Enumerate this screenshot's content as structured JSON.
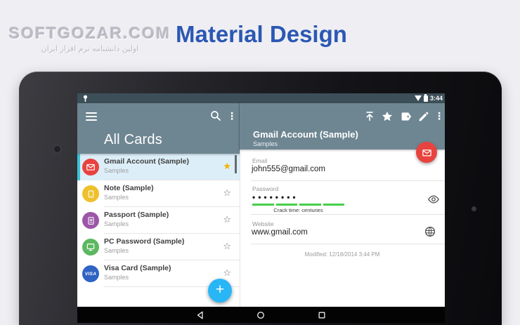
{
  "page": {
    "title": "Material Design"
  },
  "watermark": {
    "brand": "SOFTGOZAR.COM",
    "tagline": "اولین دانشنامه نرم افزار ایران"
  },
  "status_bar": {
    "time": "3:44"
  },
  "left_panel": {
    "title": "All Cards",
    "cards": [
      {
        "title": "Gmail Account (Sample)",
        "subtitle": "Samples",
        "icon": "envelope-icon",
        "color": "#e8433f",
        "starred": true,
        "selected": true
      },
      {
        "title": "Note (Sample)",
        "subtitle": "Samples",
        "icon": "note-icon",
        "color": "#eec12c",
        "starred": false,
        "selected": false
      },
      {
        "title": "Passport (Sample)",
        "subtitle": "Samples",
        "icon": "passport-icon",
        "color": "#9c56a8",
        "starred": false,
        "selected": false
      },
      {
        "title": "PC Password (Sample)",
        "subtitle": "Samples",
        "icon": "monitor-icon",
        "color": "#5cb860",
        "starred": false,
        "selected": false
      },
      {
        "title": "Visa Card (Sample)",
        "subtitle": "Samples",
        "icon": "visa-icon",
        "color": "#2f63c4",
        "icon_text": "VISA",
        "starred": false,
        "selected": false
      }
    ]
  },
  "detail_panel": {
    "title": "Gmail Account (Sample)",
    "subtitle": "Samples",
    "email": {
      "label": "Email",
      "value": "john555@gmail.com"
    },
    "password": {
      "label": "Password",
      "value": "••••••••",
      "crack_time": "Crack time: centuries"
    },
    "website": {
      "label": "Website",
      "value": "www.gmail.com"
    },
    "modified": "Modified: 12/18/2014 3:44 PM"
  },
  "icons": {
    "star_filled": "★",
    "star_outline": "☆",
    "overflow_dots": "⋮",
    "plus": "+"
  },
  "colors": {
    "app_bar": "#6e8692",
    "status_bar": "#3d4f59",
    "title_blue": "#2b58b4",
    "selected_row": "#dceef8",
    "selection_accent": "#3fc3d8",
    "fab_blue": "#29b6f6",
    "fab_red": "#e8433f",
    "strength_green": "#45cf49",
    "star_yellow": "#f2b300"
  }
}
